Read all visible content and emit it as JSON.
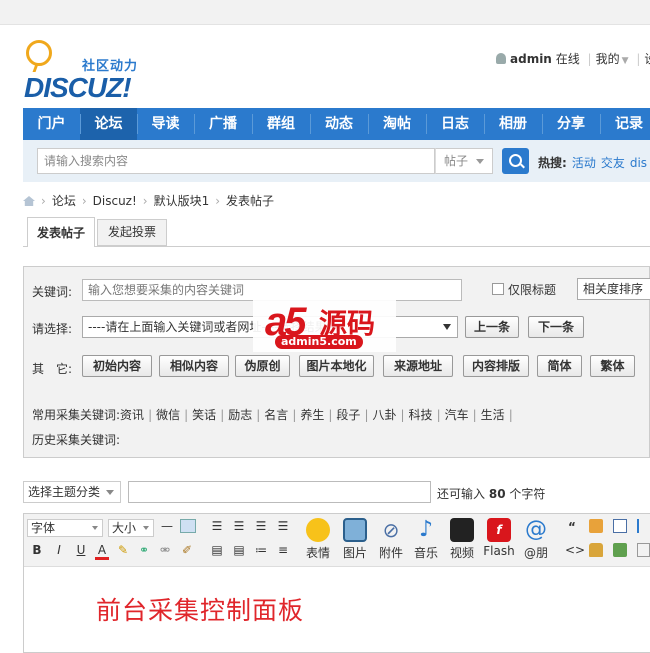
{
  "header": {
    "slogan": "社区动力",
    "logo_text": "DISCUZ!",
    "user": {
      "name": "admin",
      "status": "在线",
      "my": "我的",
      "settings": "设"
    }
  },
  "nav": [
    "门户",
    "论坛",
    "导读",
    "广播",
    "群组",
    "动态",
    "淘帖",
    "日志",
    "相册",
    "分享",
    "记录"
  ],
  "nav_active_index": 1,
  "search": {
    "placeholder": "请输入搜索内容",
    "type": "帖子",
    "hot_label": "热搜:",
    "hot_items": [
      "活动",
      "交友",
      "dis"
    ]
  },
  "breadcrumb": [
    "论坛",
    "Discuz!",
    "默认版块1",
    "发表帖子"
  ],
  "tabs": [
    "发表帖子",
    "发起投票"
  ],
  "collector": {
    "keyword_label": "关键词:",
    "keyword_placeholder": "输入您想要采集的内容关键词",
    "title_only": "仅限标题",
    "sort": "相关度排序",
    "choose_label": "请选择:",
    "choose_value": "----请在上面输入关键词或者网址----选择结果----",
    "prev": "上一条",
    "next": "下一条",
    "other_label": "其　它:",
    "buttons": [
      "初始内容",
      "相似内容",
      "伪原创",
      "图片本地化",
      "来源地址",
      "内容排版",
      "简体",
      "繁体"
    ],
    "common_label": "常用采集关键词:",
    "common_keywords": [
      "资讯",
      "微信",
      "笑话",
      "励志",
      "名言",
      "养生",
      "段子",
      "八卦",
      "科技",
      "汽车",
      "生活"
    ],
    "history_label": "历史采集关键词:"
  },
  "watermark": {
    "logo": "a5",
    "text": "源码",
    "domain": "admin5.com"
  },
  "thread": {
    "topic_select": "选择主题分类",
    "remain_prefix": "还可输入",
    "remain_count": "80",
    "remain_suffix": "个字符"
  },
  "editor": {
    "font_select": "字体",
    "size_select": "大小",
    "big_buttons": [
      "表情",
      "图片",
      "附件",
      "音乐",
      "视频",
      "Flash",
      "@朋"
    ],
    "content": "前台采集控制面板"
  },
  "colors": {
    "nav": "#2b7acd",
    "nav_active": "#1d63ac",
    "watermark": "#d9161c",
    "editor_text": "#e0262b"
  }
}
